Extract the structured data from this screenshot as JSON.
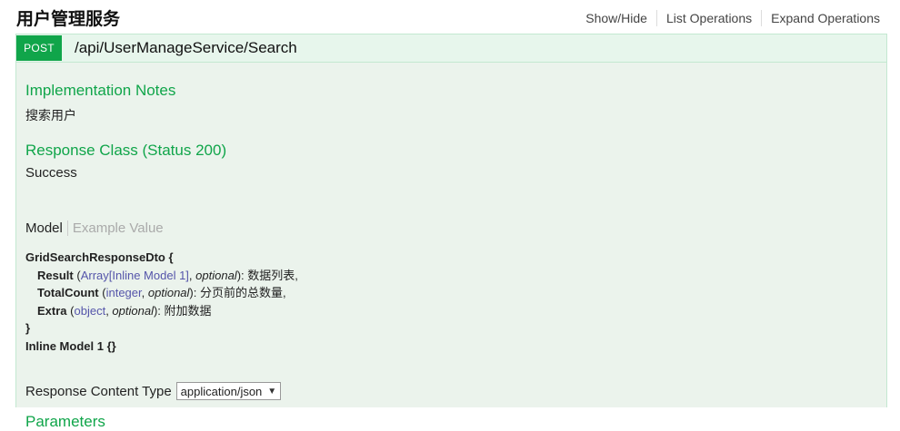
{
  "header": {
    "title": "用户管理服务",
    "ops": [
      "Show/Hide",
      "List Operations",
      "Expand Operations"
    ]
  },
  "endpoint": {
    "method": "POST",
    "path": "/api/UserManageService/Search",
    "implementation_notes": {
      "heading": "Implementation Notes",
      "text": "搜索用户"
    },
    "response_class": {
      "heading": "Response Class (Status 200)",
      "text": "Success"
    },
    "model_tabs": {
      "model": "Model",
      "example": "Example Value"
    },
    "model": {
      "name": "GridSearchResponseDto",
      "open": "{",
      "close": "}",
      "properties": [
        {
          "name": "Result",
          "type": "Array[Inline Model 1]",
          "optional": "optional",
          "desc": "数据列表,"
        },
        {
          "name": "TotalCount",
          "type": "integer",
          "optional": "optional",
          "desc": "分页前的总数量,"
        },
        {
          "name": "Extra",
          "type": "object",
          "optional": "optional",
          "desc": "附加数据"
        }
      ],
      "inline": "Inline Model 1 {}"
    },
    "response_content_type": {
      "label": "Response Content Type",
      "selected": "application/json"
    },
    "parameters_heading": "Parameters"
  }
}
